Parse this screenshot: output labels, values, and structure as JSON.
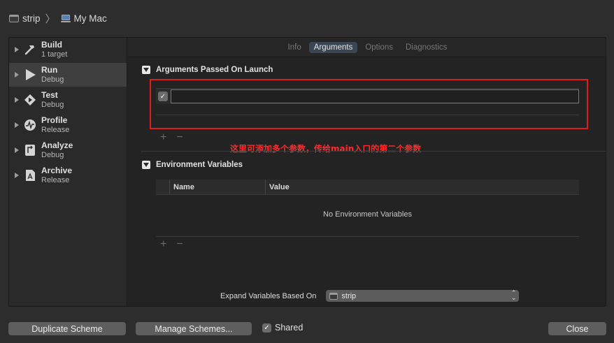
{
  "scheme_bar": {
    "scheme_name": "strip",
    "separator": "〉",
    "destination": "My Mac"
  },
  "sidebar": {
    "items": [
      {
        "title": "Build",
        "subtitle": "1 target",
        "icon": "hammer-icon"
      },
      {
        "title": "Run",
        "subtitle": "Debug",
        "icon": "play-icon",
        "selected": true
      },
      {
        "title": "Test",
        "subtitle": "Debug",
        "icon": "diamond-play-icon"
      },
      {
        "title": "Profile",
        "subtitle": "Release",
        "icon": "waveform-icon"
      },
      {
        "title": "Analyze",
        "subtitle": "Debug",
        "icon": "analyze-icon"
      },
      {
        "title": "Archive",
        "subtitle": "Release",
        "icon": "archive-icon"
      }
    ]
  },
  "tabs": [
    {
      "label": "Info",
      "active": false
    },
    {
      "label": "Arguments",
      "active": true
    },
    {
      "label": "Options",
      "active": false
    },
    {
      "label": "Diagnostics",
      "active": false
    }
  ],
  "arguments_section": {
    "title": "Arguments Passed On Launch",
    "row_value": "",
    "row_checked": true
  },
  "annotation": "这里可添加多个参数，传给main入口的第二个参数",
  "env_section": {
    "title": "Environment Variables",
    "col_name": "Name",
    "col_value": "Value",
    "empty_text": "No Environment Variables"
  },
  "controls": {
    "plus": "+",
    "minus": "−"
  },
  "expand": {
    "label": "Expand Variables Based On",
    "selected": "strip"
  },
  "bottom": {
    "duplicate_label": "Duplicate Scheme",
    "manage_label": "Manage Schemes...",
    "shared_label": "Shared",
    "shared_checked": true,
    "close_label": "Close"
  },
  "colors": {
    "annotation_red": "#e31b1b",
    "selected_tab": "#3a4654",
    "button_gray": "#5e5e5e"
  }
}
